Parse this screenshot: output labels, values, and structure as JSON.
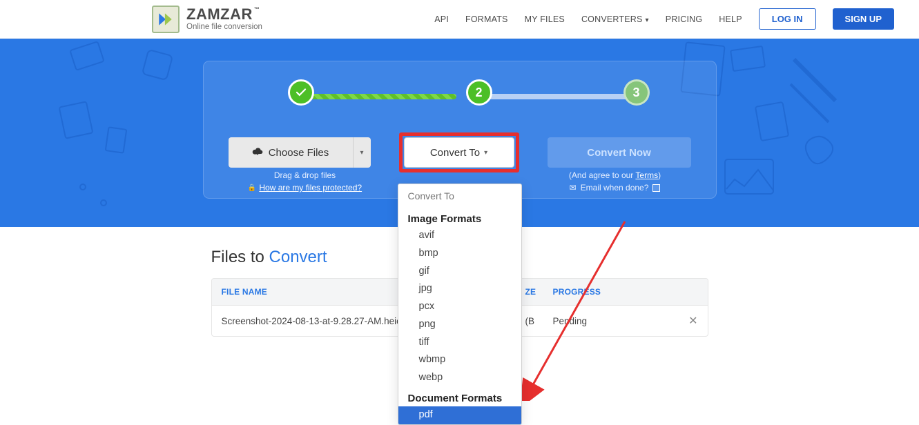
{
  "brand": {
    "name": "ZAMZAR",
    "tagline": "Online file conversion"
  },
  "nav": {
    "api": "API",
    "formats": "FORMATS",
    "myfiles": "MY FILES",
    "converters": "CONVERTERS",
    "pricing": "PRICING",
    "help": "HELP",
    "login": "LOG IN",
    "signup": "SIGN UP"
  },
  "steps": {
    "s2": "2",
    "s3": "3",
    "choose_label": "Choose Files",
    "convert_to_label": "Convert To",
    "convert_now_label": "Convert Now",
    "drag_drop": "Drag & drop files",
    "protected_q": "How are my files protected?",
    "agree_pre": "(And agree to our ",
    "agree_link": "Terms",
    "agree_post": ")",
    "email_done": "Email when done?"
  },
  "dropdown": {
    "search": "Convert To",
    "group_img": "Image Formats",
    "img": [
      "avif",
      "bmp",
      "gif",
      "jpg",
      "pcx",
      "png",
      "tiff",
      "wbmp",
      "webp"
    ],
    "group_doc": "Document Formats",
    "doc_sel": "pdf"
  },
  "files": {
    "title_a": "Files to ",
    "title_b": "Convert",
    "col_name": "FILE NAME",
    "col_size_suffix": "B",
    "col_prog": "PROGRESS",
    "rows": [
      {
        "name": "Screenshot-2024-08-13-at-9.28.27-AM.heic",
        "size_end": "(B",
        "progress": "Pending"
      }
    ]
  }
}
